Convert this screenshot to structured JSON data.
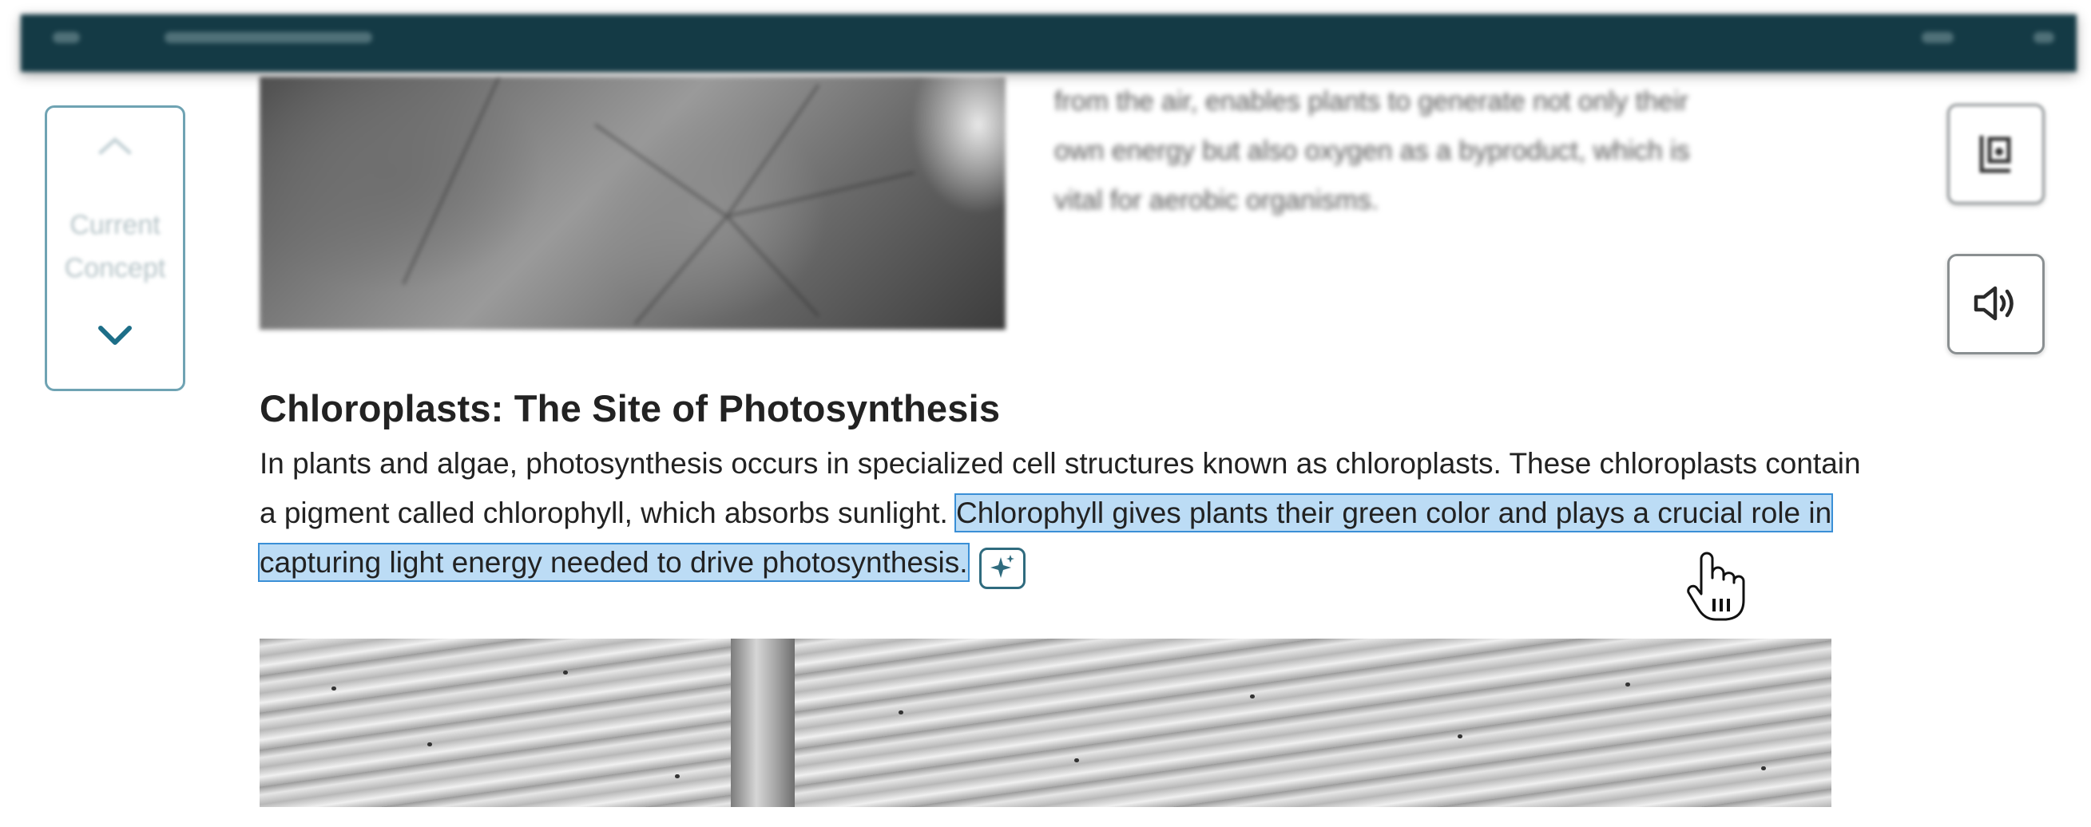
{
  "concept_nav": {
    "label_line1": "Current",
    "label_line2": "Concept"
  },
  "intro_blurred": {
    "lines": [
      "from the air, enables plants to generate not only their",
      "own energy but also oxygen as a byproduct, which is",
      "vital for aerobic organisms."
    ]
  },
  "section": {
    "title": "Chloroplasts: The Site of Photosynthesis",
    "text_before": "In plants and algae, photosynthesis occurs in specialized cell structures known as chloroplasts. These chloroplasts contain a pigment called chlorophyll, which absorbs sunlight.",
    "text_highlighted": "Chlorophyll gives plants their green color and plays a crucial role in capturing light energy needed to drive photosynthesis."
  },
  "tools": {
    "notes_icon": "notes-icon",
    "audio_icon": "speaker-icon",
    "ai_icon": "sparkle-icon"
  },
  "colors": {
    "topbar": "#143a45",
    "accent": "#1d6e88",
    "highlight": "#bcdcf5",
    "highlight_border": "#3a8fd6"
  }
}
